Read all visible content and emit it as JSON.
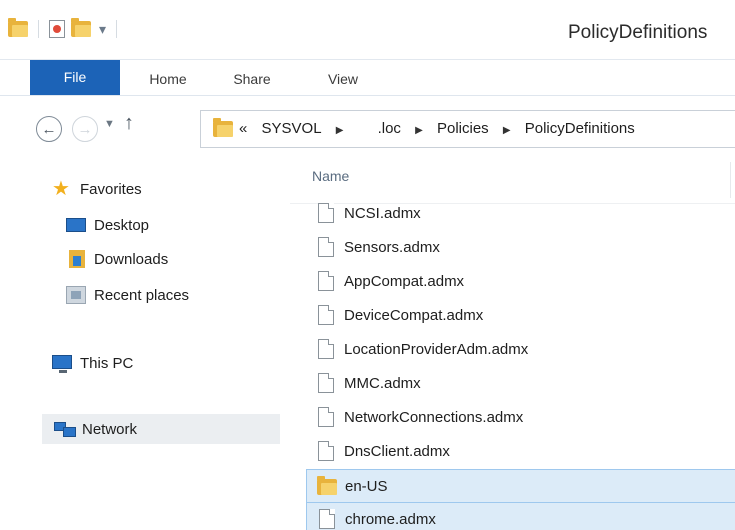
{
  "window": {
    "title": "PolicyDefinitions"
  },
  "quick_access": {
    "icons": [
      "folder-icon",
      "properties-icon",
      "new-folder-icon",
      "customize-arrow-icon"
    ]
  },
  "ribbon": {
    "tabs": [
      {
        "label": "File",
        "active": true
      },
      {
        "label": "Home"
      },
      {
        "label": "Share"
      },
      {
        "label": "View"
      }
    ]
  },
  "navigation": {
    "back_icon": "back-arrow-icon",
    "forward_icon": "forward-arrow-icon",
    "recent_icon": "chevron-down-icon",
    "up_icon": "up-arrow-icon"
  },
  "address_bar": {
    "overflow": "«",
    "crumbs": [
      "SYSVOL",
      ".loc",
      "Policies",
      "PolicyDefinitions"
    ],
    "separator": "▶"
  },
  "nav_pane": {
    "favorites": "Favorites",
    "desktop": "Desktop",
    "downloads": "Downloads",
    "recent_places": "Recent places",
    "this_pc": "This PC",
    "network": "Network"
  },
  "file_list": {
    "column_name": "Name",
    "items": [
      {
        "name": "NCSI.admx",
        "type": "file"
      },
      {
        "name": "Sensors.admx",
        "type": "file"
      },
      {
        "name": "AppCompat.admx",
        "type": "file"
      },
      {
        "name": "DeviceCompat.admx",
        "type": "file"
      },
      {
        "name": "LocationProviderAdm.admx",
        "type": "file"
      },
      {
        "name": "MMC.admx",
        "type": "file"
      },
      {
        "name": "NetworkConnections.admx",
        "type": "file"
      },
      {
        "name": "DnsClient.admx",
        "type": "file"
      },
      {
        "name": "en-US",
        "type": "folder",
        "selected": true
      },
      {
        "name": "chrome.admx",
        "type": "file",
        "selected": true
      }
    ]
  },
  "colors": {
    "file_tab": "#1c63b7",
    "selection_bg": "#dcebf8",
    "selection_border": "#9ec8ee",
    "nav_selected_bg": "#ebeef1"
  }
}
